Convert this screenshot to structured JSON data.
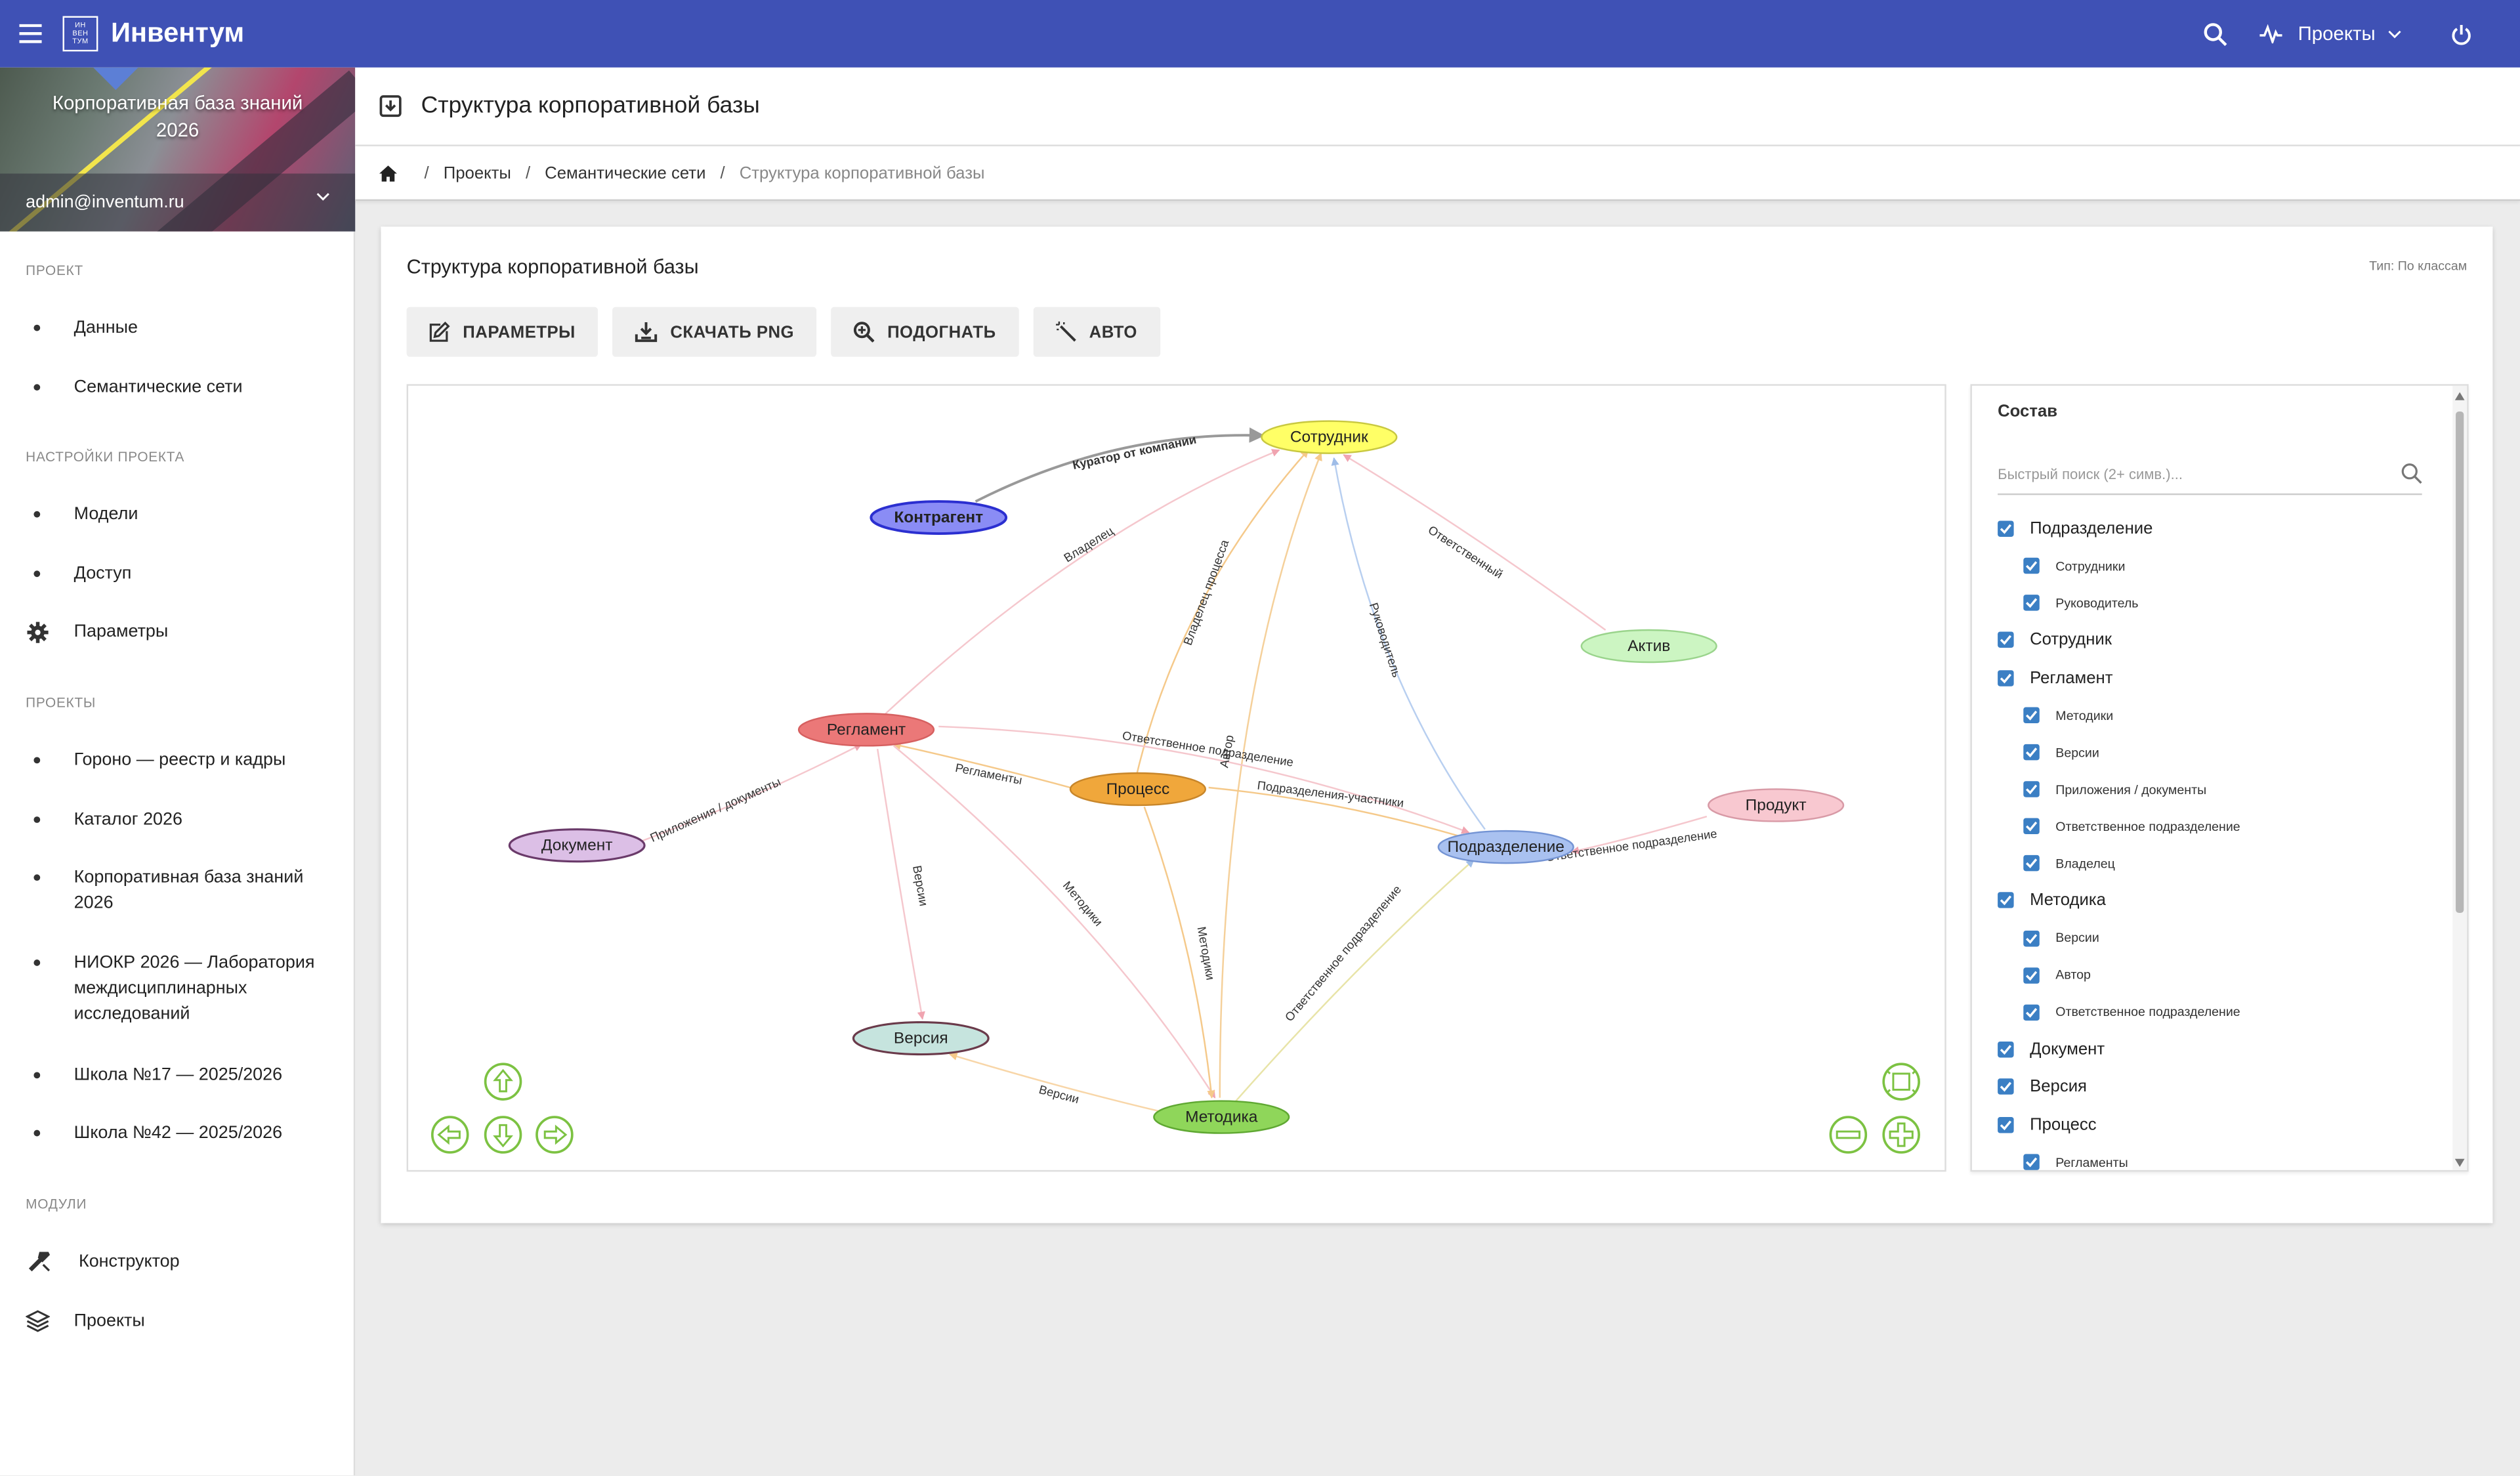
{
  "app": {
    "brand": "Инвентум",
    "logo_text": [
      "ИН",
      "ВЕН",
      "ТУМ"
    ],
    "top_menu_projects": "Проекты"
  },
  "sidebar": {
    "kb_title": "Корпоративная база знаний 2026",
    "user_email": "admin@inventum.ru",
    "sections": {
      "project": "ПРОЕКТ",
      "settings": "НАСТРОЙКИ ПРОЕКТА",
      "projects": "ПРОЕКТЫ",
      "modules": "МОДУЛИ"
    },
    "project_items": [
      "Данные",
      "Семантические сети"
    ],
    "settings_items": [
      "Модели",
      "Доступ",
      "Параметры"
    ],
    "projects_items": [
      "Гороно — реестр и кадры",
      "Каталог 2026",
      "Корпоративная база знаний 2026",
      "НИОКР 2026 — Лаборатория междисциплинарных исследований",
      "Школа №17 — 2025/2026",
      "Школа №42 — 2025/2026"
    ],
    "modules_items": [
      "Конструктор",
      "Проекты"
    ]
  },
  "page": {
    "title": "Структура корпоративной базы",
    "breadcrumbs": [
      "Проекты",
      "Семантические сети",
      "Структура корпоративной базы"
    ]
  },
  "card": {
    "title": "Структура корпоративной базы",
    "type_label": "Тип: По классам",
    "buttons": [
      "ПАРАМЕТРЫ",
      "СКАЧАТЬ PNG",
      "ПОДОГНАТЬ",
      "АВТО"
    ]
  },
  "graph": {
    "nodes": [
      {
        "id": "sotrudnik",
        "label": "Сотрудник",
        "color": "#ffff66",
        "stroke": "#c8c840"
      },
      {
        "id": "kontragent",
        "label": "Контрагент",
        "color": "#8a8cf5",
        "stroke": "#2b2fd0"
      },
      {
        "id": "aktiv",
        "label": "Актив",
        "color": "#ccf5c2",
        "stroke": "#9ad48c"
      },
      {
        "id": "reglament",
        "label": "Регламент",
        "color": "#eb7878",
        "stroke": "#d66060"
      },
      {
        "id": "process",
        "label": "Процесс",
        "color": "#f0a73b",
        "stroke": "#c8862a"
      },
      {
        "id": "dokument",
        "label": "Документ",
        "color": "#dcbfe6",
        "stroke": "#6a3a6a"
      },
      {
        "id": "produkt",
        "label": "Продукт",
        "color": "#f8c8d0",
        "stroke": "#d89aa6"
      },
      {
        "id": "podrazdelenie",
        "label": "Подразделение",
        "color": "#a9c1f0",
        "stroke": "#7494d4"
      },
      {
        "id": "versiya",
        "label": "Версия",
        "color": "#c6e4de",
        "stroke": "#6a3a4a"
      },
      {
        "id": "metodika",
        "label": "Методика",
        "color": "#8fd65a",
        "stroke": "#5fa832"
      }
    ],
    "edges": [
      {
        "label": "Куратор от компании"
      },
      {
        "label": "Владелец"
      },
      {
        "label": "Владелец процесса"
      },
      {
        "label": "Ответственный"
      },
      {
        "label": "Руководитель"
      },
      {
        "label": "Автор"
      },
      {
        "label": "Ответственное подразделение"
      },
      {
        "label": "Регламенты"
      },
      {
        "label": "Подразделения-участники"
      },
      {
        "label": "Ответственное подразделение"
      },
      {
        "label": "Приложения / документы"
      },
      {
        "label": "Версии"
      },
      {
        "label": "Методики"
      },
      {
        "label": "Методики"
      },
      {
        "label": "Ответственное подразделение"
      },
      {
        "label": "Версии"
      }
    ]
  },
  "panel": {
    "title": "Состав",
    "search_placeholder": "Быстрый поиск (2+ симв.)...",
    "tree": [
      {
        "label": "Подразделение",
        "children": [
          "Сотрудники",
          "Руководитель"
        ]
      },
      {
        "label": "Сотрудник",
        "children": []
      },
      {
        "label": "Регламент",
        "children": [
          "Методики",
          "Версии",
          "Приложения / документы",
          "Ответственное подразделение",
          "Владелец"
        ]
      },
      {
        "label": "Методика",
        "children": [
          "Версии",
          "Автор",
          "Ответственное подразделение"
        ]
      },
      {
        "label": "Документ",
        "children": []
      },
      {
        "label": "Версия",
        "children": []
      },
      {
        "label": "Процесс",
        "children": [
          "Регламенты"
        ]
      }
    ]
  },
  "colors": {
    "topbar": "#3f51b5",
    "checkbox": "#3b7fc4",
    "nav_controls": "#7cc242"
  },
  "icons": {
    "topbar": [
      "menu-icon",
      "search-icon",
      "activity-icon",
      "chevron-down-icon",
      "power-icon"
    ],
    "graph_controls": [
      "arrow-up-icon",
      "arrow-left-icon",
      "arrow-down-icon",
      "arrow-right-icon",
      "fit-icon",
      "zoom-out-icon",
      "zoom-in-icon"
    ]
  }
}
